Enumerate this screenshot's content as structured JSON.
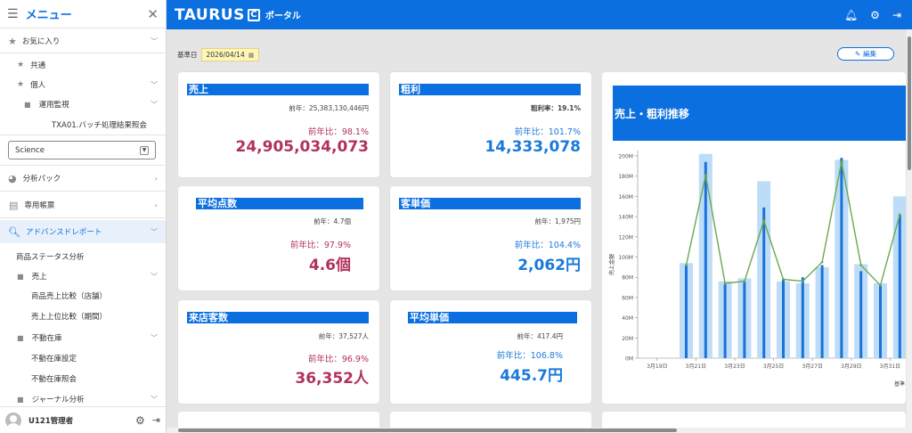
{
  "sidebar": {
    "title": "メニュー",
    "favorites": "お気に入り",
    "common": "共通",
    "personal": "個人",
    "ops_monitor": "運用監視",
    "batch": "TXA01.バッチ処理結果照会",
    "select_value": "Science",
    "analysis_pack": "分析パック",
    "dedicated_forms": "専用帳票",
    "advanced_report": "アドバンスドレポート",
    "product_status": "商品ステータス分析",
    "sales": "売上",
    "store_compare": "商品売上比較（店舗）",
    "top_sales": "売上上位比較（期間）",
    "dead_stock": "不動在庫",
    "dead_stock_setting": "不動在庫設定",
    "dead_stock_query": "不動在庫照会",
    "journal": "ジャーナル分析",
    "user": "U121管理者"
  },
  "header": {
    "brand": "TAURUS",
    "brand_mark": "C",
    "portal": "ポータル"
  },
  "main": {
    "date_label": "基準日",
    "date_value": "2026/04/14",
    "edit_label": "編集"
  },
  "cards": {
    "sales": {
      "title": "売上",
      "prev": "前年：25,383,130,446円",
      "ratio": "前年比：98.1%",
      "value": "24,905,034,073"
    },
    "gross": {
      "title": "粗利",
      "prev": "粗利率：19.1%",
      "ratio": "前年比：101.7%",
      "value": "14,333,078"
    },
    "avg_items": {
      "title": "平均点数",
      "prev": "前年：4.7個",
      "ratio": "前年比：97.9%",
      "value": "4.6個"
    },
    "unit_price": {
      "title": "客単価",
      "prev": "前年：1,975円",
      "ratio": "前年比：104.4%",
      "value": "2,062円"
    },
    "visitors": {
      "title": "来店客数",
      "prev": "前年：37,527人",
      "ratio": "前年比：96.9%",
      "value": "36,352人"
    },
    "avg_price": {
      "title": "平均単価",
      "prev": "前年：417.4円",
      "ratio": "前年比：106.8%",
      "value": "445.7円"
    }
  },
  "colors": {
    "accent": "#0b6fe0",
    "red_value": "#b0325b",
    "blue_value": "#1a7ad9",
    "bar_light": "#bcdcf7",
    "bar_dark": "#1a73d9",
    "line_green": "#6aa84f"
  },
  "chart_data": {
    "type": "bar",
    "title": "売上・粗利推移",
    "ylabel": "売上金額",
    "xlabel": "基準",
    "ylim": [
      0,
      200
    ],
    "yticks": [
      "0M",
      "20M",
      "40M",
      "60M",
      "80M",
      "100M",
      "120M",
      "140M",
      "160M",
      "180M",
      "200M"
    ],
    "x_labels": [
      "3月19日",
      "3月21日",
      "3月23日",
      "3月25日",
      "3月27日",
      "3月29日",
      "3月31日"
    ],
    "series": [
      {
        "values": [
          0,
          0,
          94,
          202,
          76,
          79,
          175,
          76,
          74,
          90,
          196,
          93,
          74,
          160
        ]
      },
      {
        "values": [
          0,
          0,
          92,
          194,
          73,
          75,
          149,
          78,
          80,
          92,
          198,
          86,
          72,
          142
        ]
      },
      {
        "values": [
          null,
          null,
          92,
          181,
          74,
          76,
          136,
          78,
          76,
          95,
          194,
          92,
          72,
          142
        ]
      }
    ],
    "grid": false
  }
}
